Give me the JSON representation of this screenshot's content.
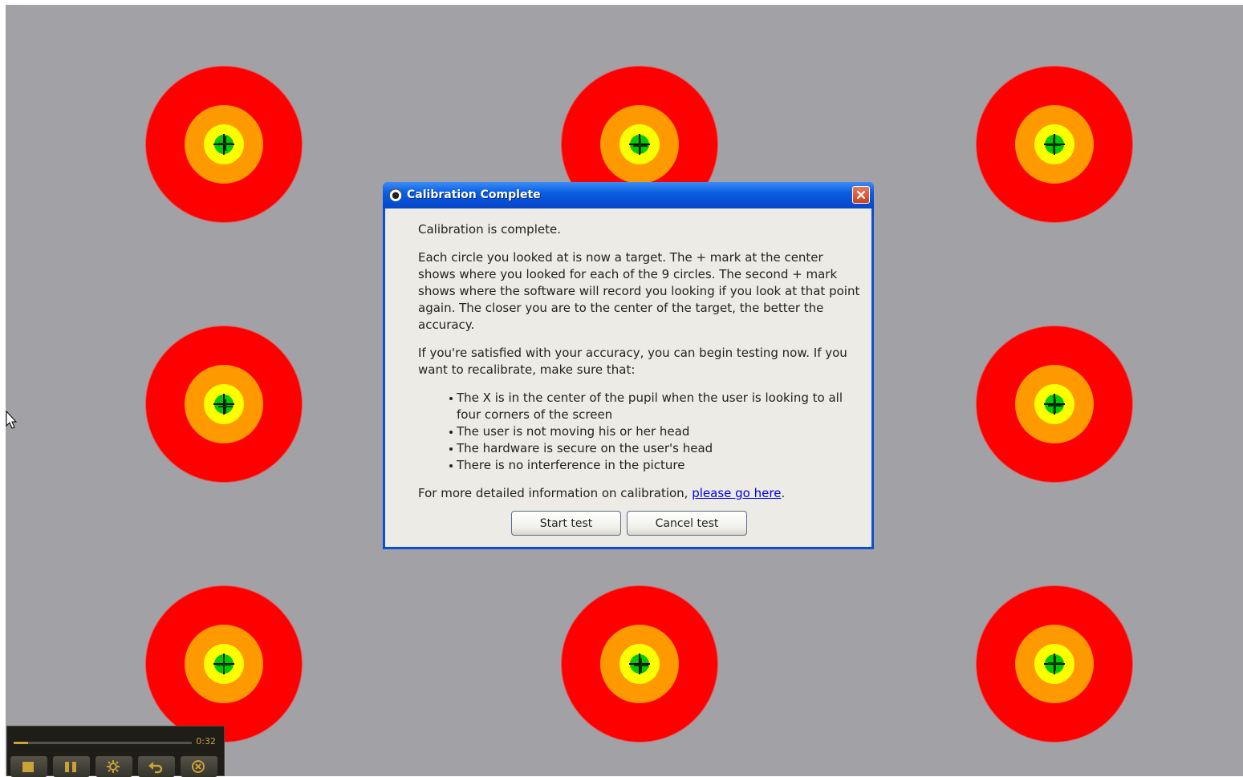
{
  "dialog": {
    "title": "Calibration Complete",
    "p1": "Calibration is complete.",
    "p2": "Each circle you looked at is now a target. The + mark at the center shows where you looked for each of the 9 circles. The second + mark shows where the software will record you looking if you look at that point again. The closer you are to the center of the target, the better the accuracy.",
    "p3": "If you're satisfied with your accuracy, you can begin testing now. If you want to recalibrate, make sure that:",
    "bullets": [
      "The X is in the center of the pupil when the user is looking to all four corners of the screen",
      "The user is not moving his or her head",
      "The hardware is secure on the user's head",
      "There is no interference in the picture"
    ],
    "more_info_prefix": "For more detailed information on calibration, ",
    "more_info_link": "please go here",
    "more_info_suffix": ".",
    "start_button": "Start test",
    "cancel_button": "Cancel test"
  },
  "player": {
    "time": "0:32",
    "progress": 0.08,
    "buttons": [
      "stop-icon",
      "pause-icon",
      "settings-icon",
      "undo-icon",
      "close-icon"
    ]
  },
  "targets": {
    "count": 9,
    "colors": [
      "#ff0000",
      "#ff9900",
      "#ffff00",
      "#00cc00"
    ]
  },
  "colors": {
    "background": "#a2a1a6",
    "titlebar": "#0a5fe0",
    "dialog_bg": "#ecebe5",
    "link": "#0000ee"
  }
}
